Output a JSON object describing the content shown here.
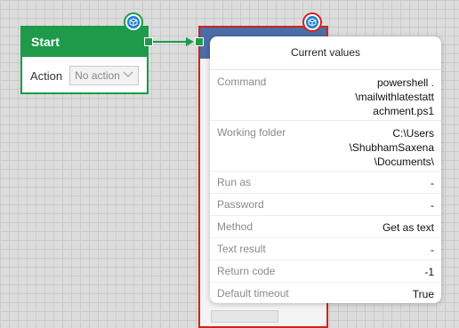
{
  "start_node": {
    "title": "Start",
    "action_label": "Action",
    "action_value": "No action"
  },
  "popup": {
    "title": "Current values",
    "rows": [
      {
        "key": "Command",
        "value": "powershell .\n\\mailwithlatestatt\nachment.ps1"
      },
      {
        "key": "Working folder",
        "value": "C:\\Users\n\\ShubhamSaxena\n\\Documents\\"
      },
      {
        "key": "Run as",
        "value": "-"
      },
      {
        "key": "Password",
        "value": "-"
      },
      {
        "key": "Method",
        "value": "Get as text"
      },
      {
        "key": "Text result",
        "value": "-"
      },
      {
        "key": "Return code",
        "value": "-1"
      },
      {
        "key": "Default timeout",
        "value": "True"
      }
    ]
  },
  "colors": {
    "start_green": "#1d9b4a",
    "command_red": "#d0231d",
    "command_header_blue": "#4b6ea6",
    "badge_blue": "#1f7fd0"
  }
}
